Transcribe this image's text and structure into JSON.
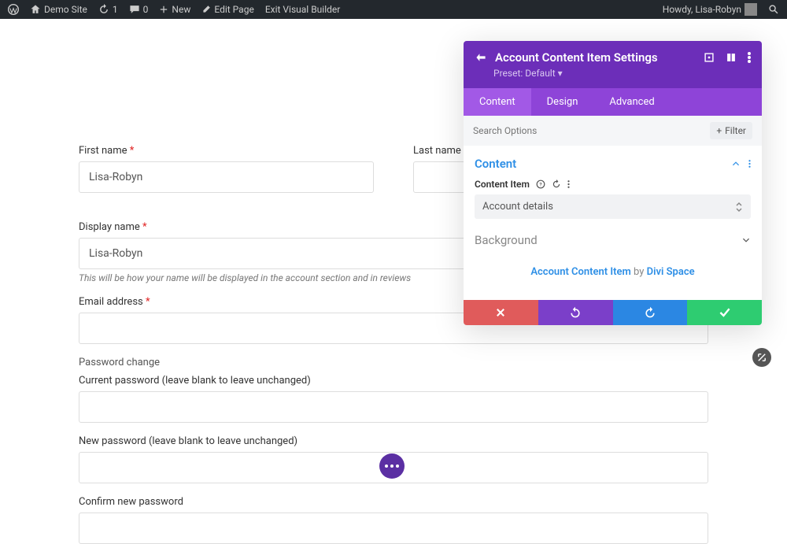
{
  "adminbar": {
    "site": "Demo Site",
    "refresh": "1",
    "comments": "0",
    "new": "New",
    "edit": "Edit Page",
    "exit": "Exit Visual Builder",
    "howdy": "Howdy, Lisa-Robyn"
  },
  "form": {
    "first_name_label": "First name",
    "first_name_value": "Lisa-Robyn",
    "last_name_label": "Last name",
    "last_name_value": "",
    "display_name_label": "Display name",
    "display_name_value": "Lisa-Robyn",
    "display_hint": "This will be how your name will be displayed in the account section and in reviews",
    "email_label": "Email address",
    "email_value": "",
    "password_section": "Password change",
    "current_pw_label": "Current password (leave blank to leave unchanged)",
    "new_pw_label": "New password (leave blank to leave unchanged)",
    "confirm_pw_label": "Confirm new password"
  },
  "panel": {
    "title": "Account Content Item Settings",
    "preset": "Preset: Default",
    "tabs": {
      "content": "Content",
      "design": "Design",
      "advanced": "Advanced"
    },
    "search_placeholder": "Search Options",
    "filter": "Filter",
    "section_content": "Content",
    "content_item_label": "Content Item",
    "content_item_value": "Account details",
    "section_background": "Background",
    "credit_link": "Account Content Item",
    "credit_by": "by",
    "credit_author": "Divi Space"
  }
}
